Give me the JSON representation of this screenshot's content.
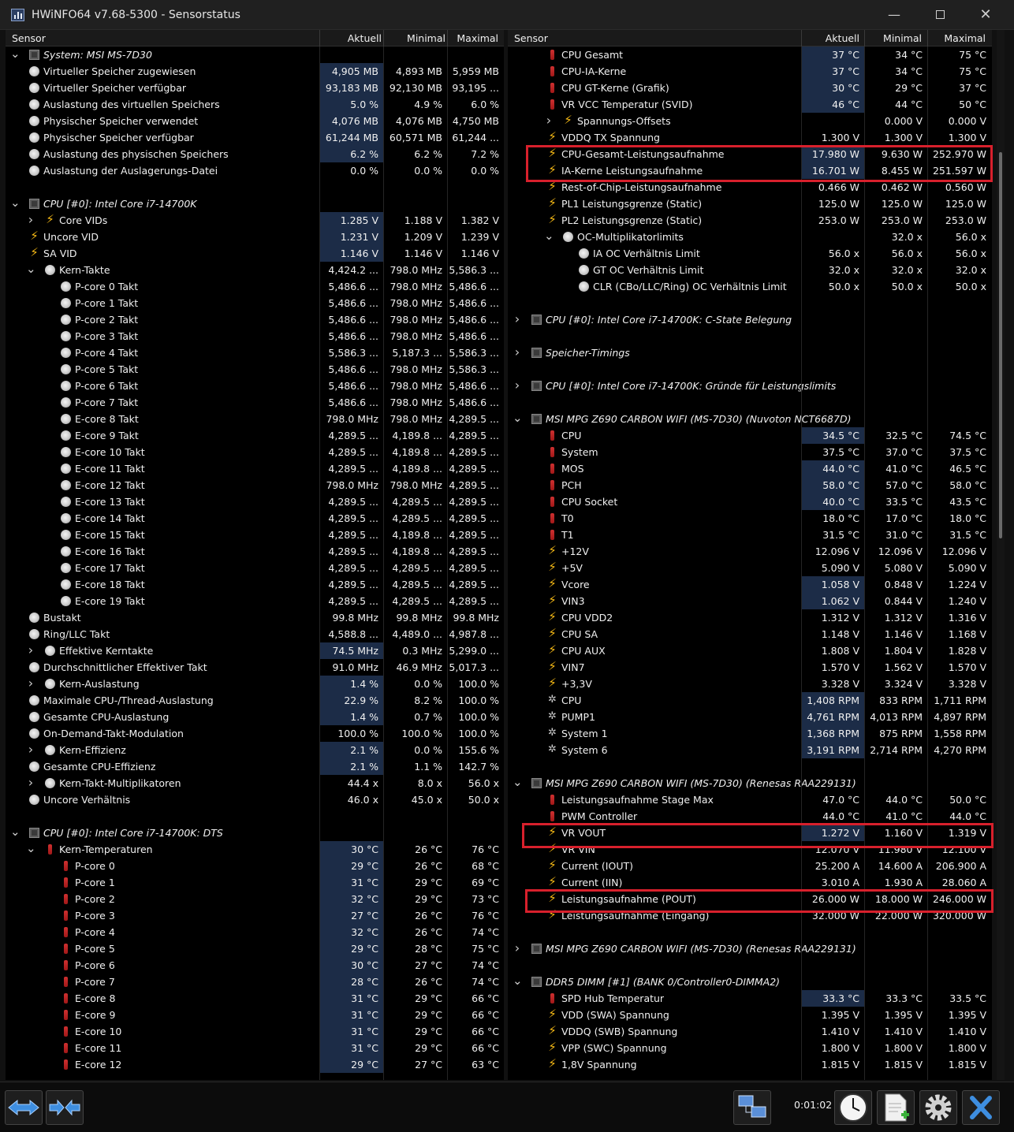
{
  "window": {
    "title": "HWiNFO64 v7.68-5300 - Sensorstatus"
  },
  "columns": {
    "sensor": "Sensor",
    "current": "Aktuell",
    "min": "Minimal",
    "max": "Maximal"
  },
  "left_rows": [
    {
      "exp": "v",
      "icon": "chip",
      "indent": 0,
      "name": "System: MSI MS-7D30",
      "group": true
    },
    {
      "icon": "clock",
      "indent": 0,
      "name": "Virtueller Speicher zugewiesen",
      "cur": "4,905 MB",
      "min": "4,893 MB",
      "max": "5,959 MB",
      "hl": true
    },
    {
      "icon": "clock",
      "indent": 0,
      "name": "Virtueller Speicher verfügbar",
      "cur": "93,183 MB",
      "min": "92,130 MB",
      "max": "93,195 ...",
      "hl": true
    },
    {
      "icon": "clock",
      "indent": 0,
      "name": "Auslastung des virtuellen Speichers",
      "cur": "5.0 %",
      "min": "4.9 %",
      "max": "6.0 %",
      "hl": true
    },
    {
      "icon": "clock",
      "indent": 0,
      "name": "Physischer Speicher verwendet",
      "cur": "4,076 MB",
      "min": "4,076 MB",
      "max": "4,750 MB",
      "hl": true
    },
    {
      "icon": "clock",
      "indent": 0,
      "name": "Physischer Speicher verfügbar",
      "cur": "61,244 MB",
      "min": "60,571 MB",
      "max": "61,244 ...",
      "hl": true
    },
    {
      "icon": "clock",
      "indent": 0,
      "name": "Auslastung des physischen Speichers",
      "cur": "6.2 %",
      "min": "6.2 %",
      "max": "7.2 %",
      "hl": true
    },
    {
      "icon": "clock",
      "indent": 0,
      "name": "Auslastung der Auslagerungs-Datei",
      "cur": "0.0 %",
      "min": "0.0 %",
      "max": "0.0 %"
    },
    {
      "empty": true
    },
    {
      "exp": "v",
      "icon": "chip",
      "indent": 0,
      "name": "CPU [#0]: Intel Core i7-14700K",
      "group": true
    },
    {
      "exp": ">",
      "icon": "bolt",
      "indent": 1,
      "name": "Core VIDs",
      "cur": "1.285 V",
      "min": "1.188 V",
      "max": "1.382 V",
      "hl": true
    },
    {
      "icon": "bolt",
      "indent": 0,
      "name": "Uncore VID",
      "cur": "1.231 V",
      "min": "1.209 V",
      "max": "1.239 V",
      "hl": true
    },
    {
      "icon": "bolt",
      "indent": 0,
      "name": "SA VID",
      "cur": "1.146 V",
      "min": "1.146 V",
      "max": "1.146 V",
      "hl": true
    },
    {
      "exp": "v",
      "icon": "clock",
      "indent": 1,
      "name": "Kern-Takte",
      "cur": "4,424.2 ...",
      "min": "798.0 MHz",
      "max": "5,586.3 ..."
    },
    {
      "icon": "clock",
      "indent": 2,
      "name": "P-core 0 Takt",
      "cur": "5,486.6 ...",
      "min": "798.0 MHz",
      "max": "5,486.6 ..."
    },
    {
      "icon": "clock",
      "indent": 2,
      "name": "P-core 1 Takt",
      "cur": "5,486.6 ...",
      "min": "798.0 MHz",
      "max": "5,486.6 ..."
    },
    {
      "icon": "clock",
      "indent": 2,
      "name": "P-core 2 Takt",
      "cur": "5,486.6 ...",
      "min": "798.0 MHz",
      "max": "5,486.6 ..."
    },
    {
      "icon": "clock",
      "indent": 2,
      "name": "P-core 3 Takt",
      "cur": "5,486.6 ...",
      "min": "798.0 MHz",
      "max": "5,486.6 ..."
    },
    {
      "icon": "clock",
      "indent": 2,
      "name": "P-core 4 Takt",
      "cur": "5,586.3 ...",
      "min": "5,187.3 ...",
      "max": "5,586.3 ..."
    },
    {
      "icon": "clock",
      "indent": 2,
      "name": "P-core 5 Takt",
      "cur": "5,486.6 ...",
      "min": "798.0 MHz",
      "max": "5,586.3 ..."
    },
    {
      "icon": "clock",
      "indent": 2,
      "name": "P-core 6 Takt",
      "cur": "5,486.6 ...",
      "min": "798.0 MHz",
      "max": "5,486.6 ..."
    },
    {
      "icon": "clock",
      "indent": 2,
      "name": "P-core 7 Takt",
      "cur": "5,486.6 ...",
      "min": "798.0 MHz",
      "max": "5,486.6 ..."
    },
    {
      "icon": "clock",
      "indent": 2,
      "name": "E-core 8 Takt",
      "cur": "798.0 MHz",
      "min": "798.0 MHz",
      "max": "4,289.5 ..."
    },
    {
      "icon": "clock",
      "indent": 2,
      "name": "E-core 9 Takt",
      "cur": "4,289.5 ...",
      "min": "4,189.8 ...",
      "max": "4,289.5 ..."
    },
    {
      "icon": "clock",
      "indent": 2,
      "name": "E-core 10 Takt",
      "cur": "4,289.5 ...",
      "min": "4,189.8 ...",
      "max": "4,289.5 ..."
    },
    {
      "icon": "clock",
      "indent": 2,
      "name": "E-core 11 Takt",
      "cur": "4,289.5 ...",
      "min": "4,189.8 ...",
      "max": "4,289.5 ..."
    },
    {
      "icon": "clock",
      "indent": 2,
      "name": "E-core 12 Takt",
      "cur": "798.0 MHz",
      "min": "798.0 MHz",
      "max": "4,289.5 ..."
    },
    {
      "icon": "clock",
      "indent": 2,
      "name": "E-core 13 Takt",
      "cur": "4,289.5 ...",
      "min": "4,289.5 ...",
      "max": "4,289.5 ..."
    },
    {
      "icon": "clock",
      "indent": 2,
      "name": "E-core 14 Takt",
      "cur": "4,289.5 ...",
      "min": "4,289.5 ...",
      "max": "4,289.5 ..."
    },
    {
      "icon": "clock",
      "indent": 2,
      "name": "E-core 15 Takt",
      "cur": "4,289.5 ...",
      "min": "4,189.8 ...",
      "max": "4,289.5 ..."
    },
    {
      "icon": "clock",
      "indent": 2,
      "name": "E-core 16 Takt",
      "cur": "4,289.5 ...",
      "min": "4,189.8 ...",
      "max": "4,289.5 ..."
    },
    {
      "icon": "clock",
      "indent": 2,
      "name": "E-core 17 Takt",
      "cur": "4,289.5 ...",
      "min": "4,289.5 ...",
      "max": "4,289.5 ..."
    },
    {
      "icon": "clock",
      "indent": 2,
      "name": "E-core 18 Takt",
      "cur": "4,289.5 ...",
      "min": "4,289.5 ...",
      "max": "4,289.5 ..."
    },
    {
      "icon": "clock",
      "indent": 2,
      "name": "E-core 19 Takt",
      "cur": "4,289.5 ...",
      "min": "4,289.5 ...",
      "max": "4,289.5 ..."
    },
    {
      "icon": "clock",
      "indent": 0,
      "name": "Bustakt",
      "cur": "99.8 MHz",
      "min": "99.8 MHz",
      "max": "99.8 MHz"
    },
    {
      "icon": "clock",
      "indent": 0,
      "name": "Ring/LLC Takt",
      "cur": "4,588.8 ...",
      "min": "4,489.0 ...",
      "max": "4,987.8 ..."
    },
    {
      "exp": ">",
      "icon": "clock",
      "indent": 1,
      "name": "Effektive Kerntakte",
      "cur": "74.5 MHz",
      "min": "0.3 MHz",
      "max": "5,299.0 ...",
      "hl": true
    },
    {
      "icon": "clock",
      "indent": 0,
      "name": "Durchschnittlicher Effektiver Takt",
      "cur": "91.0 MHz",
      "min": "46.9 MHz",
      "max": "5,017.3 ..."
    },
    {
      "exp": ">",
      "icon": "clock",
      "indent": 1,
      "name": "Kern-Auslastung",
      "cur": "1.4 %",
      "min": "0.0 %",
      "max": "100.0 %",
      "hl": true
    },
    {
      "icon": "clock",
      "indent": 0,
      "name": "Maximale CPU-/Thread-Auslastung",
      "cur": "22.9 %",
      "min": "8.2 %",
      "max": "100.0 %",
      "hl": true
    },
    {
      "icon": "clock",
      "indent": 0,
      "name": "Gesamte CPU-Auslastung",
      "cur": "1.4 %",
      "min": "0.7 %",
      "max": "100.0 %",
      "hl": true
    },
    {
      "icon": "clock",
      "indent": 0,
      "name": "On-Demand-Takt-Modulation",
      "cur": "100.0 %",
      "min": "100.0 %",
      "max": "100.0 %"
    },
    {
      "exp": ">",
      "icon": "clock",
      "indent": 1,
      "name": "Kern-Effizienz",
      "cur": "2.1 %",
      "min": "0.0 %",
      "max": "155.6 %",
      "hl": true
    },
    {
      "icon": "clock",
      "indent": 0,
      "name": "Gesamte CPU-Effizienz",
      "cur": "2.1 %",
      "min": "1.1 %",
      "max": "142.7 %",
      "hl": true
    },
    {
      "exp": ">",
      "icon": "clock",
      "indent": 1,
      "name": "Kern-Takt-Multiplikatoren",
      "cur": "44.4 x",
      "min": "8.0 x",
      "max": "56.0 x"
    },
    {
      "icon": "clock",
      "indent": 0,
      "name": "Uncore Verhältnis",
      "cur": "46.0 x",
      "min": "45.0 x",
      "max": "50.0 x"
    },
    {
      "empty": true
    },
    {
      "exp": "v",
      "icon": "chip",
      "indent": 0,
      "name": "CPU [#0]: Intel Core i7-14700K: DTS",
      "group": true
    },
    {
      "exp": "v",
      "icon": "therm",
      "indent": 1,
      "name": "Kern-Temperaturen",
      "cur": "30 °C",
      "min": "26 °C",
      "max": "76 °C",
      "hl": true
    },
    {
      "icon": "therm",
      "indent": 2,
      "name": "P-core 0",
      "cur": "29 °C",
      "min": "26 °C",
      "max": "68 °C",
      "hl": true
    },
    {
      "icon": "therm",
      "indent": 2,
      "name": "P-core 1",
      "cur": "31 °C",
      "min": "29 °C",
      "max": "69 °C",
      "hl": true
    },
    {
      "icon": "therm",
      "indent": 2,
      "name": "P-core 2",
      "cur": "32 °C",
      "min": "29 °C",
      "max": "73 °C",
      "hl": true
    },
    {
      "icon": "therm",
      "indent": 2,
      "name": "P-core 3",
      "cur": "27 °C",
      "min": "26 °C",
      "max": "76 °C",
      "hl": true
    },
    {
      "icon": "therm",
      "indent": 2,
      "name": "P-core 4",
      "cur": "32 °C",
      "min": "26 °C",
      "max": "74 °C",
      "hl": true
    },
    {
      "icon": "therm",
      "indent": 2,
      "name": "P-core 5",
      "cur": "29 °C",
      "min": "28 °C",
      "max": "75 °C",
      "hl": true
    },
    {
      "icon": "therm",
      "indent": 2,
      "name": "P-core 6",
      "cur": "30 °C",
      "min": "27 °C",
      "max": "74 °C",
      "hl": true
    },
    {
      "icon": "therm",
      "indent": 2,
      "name": "P-core 7",
      "cur": "28 °C",
      "min": "26 °C",
      "max": "74 °C",
      "hl": true
    },
    {
      "icon": "therm",
      "indent": 2,
      "name": "E-core 8",
      "cur": "31 °C",
      "min": "29 °C",
      "max": "66 °C",
      "hl": true
    },
    {
      "icon": "therm",
      "indent": 2,
      "name": "E-core 9",
      "cur": "31 °C",
      "min": "29 °C",
      "max": "66 °C",
      "hl": true
    },
    {
      "icon": "therm",
      "indent": 2,
      "name": "E-core 10",
      "cur": "31 °C",
      "min": "29 °C",
      "max": "66 °C",
      "hl": true
    },
    {
      "icon": "therm",
      "indent": 2,
      "name": "E-core 11",
      "cur": "31 °C",
      "min": "29 °C",
      "max": "66 °C",
      "hl": true
    },
    {
      "icon": "therm",
      "indent": 2,
      "name": "E-core 12",
      "cur": "29 °C",
      "min": "27 °C",
      "max": "63 °C",
      "hl": true
    }
  ],
  "right_rows": [
    {
      "icon": "therm",
      "indent": 1,
      "name": "CPU Gesamt",
      "cur": "37 °C",
      "min": "34 °C",
      "max": "75 °C",
      "hl": true
    },
    {
      "icon": "therm",
      "indent": 1,
      "name": "CPU-IA-Kerne",
      "cur": "37 °C",
      "min": "34 °C",
      "max": "75 °C",
      "hl": true
    },
    {
      "icon": "therm",
      "indent": 1,
      "name": "CPU GT-Kerne (Grafik)",
      "cur": "30 °C",
      "min": "29 °C",
      "max": "37 °C",
      "hl": true
    },
    {
      "icon": "therm",
      "indent": 1,
      "name": "VR VCC Temperatur (SVID)",
      "cur": "46 °C",
      "min": "44 °C",
      "max": "50 °C",
      "hl": true
    },
    {
      "exp": ">",
      "icon": "bolt",
      "indent": 2,
      "name": "Spannungs-Offsets",
      "cur": "",
      "min": "0.000 V",
      "max": "0.000 V"
    },
    {
      "icon": "bolt",
      "indent": 1,
      "name": "VDDQ TX Spannung",
      "cur": "1.300 V",
      "min": "1.300 V",
      "max": "1.300 V"
    },
    {
      "icon": "bolt",
      "indent": 1,
      "name": "CPU-Gesamt-Leistungsaufnahme",
      "cur": "17.980 W",
      "min": "9.630 W",
      "max": "252.970 W",
      "hl": true
    },
    {
      "icon": "bolt",
      "indent": 1,
      "name": "IA-Kerne Leistungsaufnahme",
      "cur": "16.701 W",
      "min": "8.455 W",
      "max": "251.597 W",
      "hl": true
    },
    {
      "icon": "bolt",
      "indent": 1,
      "name": "Rest-of-Chip-Leistungsaufnahme",
      "cur": "0.466 W",
      "min": "0.462 W",
      "max": "0.560 W"
    },
    {
      "icon": "bolt",
      "indent": 1,
      "name": "PL1 Leistungsgrenze (Static)",
      "cur": "125.0 W",
      "min": "125.0 W",
      "max": "125.0 W"
    },
    {
      "icon": "bolt",
      "indent": 1,
      "name": "PL2 Leistungsgrenze (Static)",
      "cur": "253.0 W",
      "min": "253.0 W",
      "max": "253.0 W"
    },
    {
      "exp": "v",
      "icon": "clock",
      "indent": 2,
      "name": "OC-Multiplikatorlimits",
      "cur": "",
      "min": "32.0 x",
      "max": "56.0 x"
    },
    {
      "icon": "clock",
      "indent": 3,
      "name": "IA OC Verhältnis Limit",
      "cur": "56.0 x",
      "min": "56.0 x",
      "max": "56.0 x"
    },
    {
      "icon": "clock",
      "indent": 3,
      "name": "GT OC Verhältnis Limit",
      "cur": "32.0 x",
      "min": "32.0 x",
      "max": "32.0 x"
    },
    {
      "icon": "clock",
      "indent": 3,
      "name": "CLR (CBo/LLC/Ring) OC Verhältnis Limit",
      "cur": "50.0 x",
      "min": "50.0 x",
      "max": "50.0 x"
    },
    {
      "empty": true
    },
    {
      "exp": ">",
      "icon": "chip",
      "indent": 0,
      "name": "CPU [#0]: Intel Core i7-14700K: C-State Belegung",
      "group": true
    },
    {
      "empty": true
    },
    {
      "exp": ">",
      "icon": "chip",
      "indent": 0,
      "name": "Speicher-Timings",
      "group": true
    },
    {
      "empty": true
    },
    {
      "exp": ">",
      "icon": "chip",
      "indent": 0,
      "name": "CPU [#0]: Intel Core i7-14700K: Gründe für Leistungslimits",
      "group": true
    },
    {
      "empty": true
    },
    {
      "exp": "v",
      "icon": "chip",
      "indent": 0,
      "name": "MSI MPG Z690 CARBON WIFI (MS-7D30) (Nuvoton NCT6687D)",
      "group": true
    },
    {
      "icon": "therm",
      "indent": 1,
      "name": "CPU",
      "cur": "34.5 °C",
      "min": "32.5 °C",
      "max": "74.5 °C",
      "hl": true
    },
    {
      "icon": "therm",
      "indent": 1,
      "name": "System",
      "cur": "37.5 °C",
      "min": "37.0 °C",
      "max": "37.5 °C"
    },
    {
      "icon": "therm",
      "indent": 1,
      "name": "MOS",
      "cur": "44.0 °C",
      "min": "41.0 °C",
      "max": "46.5 °C",
      "hl": true
    },
    {
      "icon": "therm",
      "indent": 1,
      "name": "PCH",
      "cur": "58.0 °C",
      "min": "57.0 °C",
      "max": "58.0 °C",
      "hl": true
    },
    {
      "icon": "therm",
      "indent": 1,
      "name": "CPU Socket",
      "cur": "40.0 °C",
      "min": "33.5 °C",
      "max": "43.5 °C",
      "hl": true
    },
    {
      "icon": "therm",
      "indent": 1,
      "name": "T0",
      "cur": "18.0 °C",
      "min": "17.0 °C",
      "max": "18.0 °C"
    },
    {
      "icon": "therm",
      "indent": 1,
      "name": "T1",
      "cur": "31.5 °C",
      "min": "31.0 °C",
      "max": "31.5 °C"
    },
    {
      "icon": "bolt",
      "indent": 1,
      "name": "+12V",
      "cur": "12.096 V",
      "min": "12.096 V",
      "max": "12.096 V"
    },
    {
      "icon": "bolt",
      "indent": 1,
      "name": "+5V",
      "cur": "5.090 V",
      "min": "5.080 V",
      "max": "5.090 V"
    },
    {
      "icon": "bolt",
      "indent": 1,
      "name": "Vcore",
      "cur": "1.058 V",
      "min": "0.848 V",
      "max": "1.224 V",
      "hl": true
    },
    {
      "icon": "bolt",
      "indent": 1,
      "name": "VIN3",
      "cur": "1.062 V",
      "min": "0.844 V",
      "max": "1.240 V",
      "hl": true
    },
    {
      "icon": "bolt",
      "indent": 1,
      "name": "CPU VDD2",
      "cur": "1.312 V",
      "min": "1.312 V",
      "max": "1.316 V"
    },
    {
      "icon": "bolt",
      "indent": 1,
      "name": "CPU SA",
      "cur": "1.148 V",
      "min": "1.146 V",
      "max": "1.168 V"
    },
    {
      "icon": "bolt",
      "indent": 1,
      "name": "CPU AUX",
      "cur": "1.808 V",
      "min": "1.804 V",
      "max": "1.828 V"
    },
    {
      "icon": "bolt",
      "indent": 1,
      "name": "VIN7",
      "cur": "1.570 V",
      "min": "1.562 V",
      "max": "1.570 V"
    },
    {
      "icon": "bolt",
      "indent": 1,
      "name": "+3,3V",
      "cur": "3.328 V",
      "min": "3.324 V",
      "max": "3.328 V"
    },
    {
      "icon": "fan",
      "indent": 1,
      "name": "CPU",
      "cur": "1,408 RPM",
      "min": "833 RPM",
      "max": "1,711 RPM",
      "hl": true
    },
    {
      "icon": "fan",
      "indent": 1,
      "name": "PUMP1",
      "cur": "4,761 RPM",
      "min": "4,013 RPM",
      "max": "4,897 RPM",
      "hl": true
    },
    {
      "icon": "fan",
      "indent": 1,
      "name": "System 1",
      "cur": "1,368 RPM",
      "min": "875 RPM",
      "max": "1,558 RPM",
      "hl": true
    },
    {
      "icon": "fan",
      "indent": 1,
      "name": "System 6",
      "cur": "3,191 RPM",
      "min": "2,714 RPM",
      "max": "4,270 RPM",
      "hl": true
    },
    {
      "empty": true
    },
    {
      "exp": "v",
      "icon": "chip",
      "indent": 0,
      "name": "MSI MPG Z690 CARBON WIFI (MS-7D30) (Renesas RAA229131)",
      "group": true
    },
    {
      "icon": "therm",
      "indent": 1,
      "name": "Leistungsaufnahme Stage Max",
      "cur": "47.0 °C",
      "min": "44.0 °C",
      "max": "50.0 °C"
    },
    {
      "icon": "therm",
      "indent": 1,
      "name": "PWM Controller",
      "cur": "44.0 °C",
      "min": "41.0 °C",
      "max": "44.0 °C"
    },
    {
      "icon": "bolt",
      "indent": 1,
      "name": "VR VOUT",
      "cur": "1.272 V",
      "min": "1.160 V",
      "max": "1.319 V",
      "hl": true
    },
    {
      "icon": "bolt",
      "indent": 1,
      "name": "VR VIN",
      "cur": "12.070 V",
      "min": "11.980 V",
      "max": "12.100 V"
    },
    {
      "icon": "bolt",
      "indent": 1,
      "name": "Current (IOUT)",
      "cur": "25.200 A",
      "min": "14.600 A",
      "max": "206.900 A"
    },
    {
      "icon": "bolt",
      "indent": 1,
      "name": "Current (IIN)",
      "cur": "3.010 A",
      "min": "1.930 A",
      "max": "28.060 A"
    },
    {
      "icon": "bolt",
      "indent": 1,
      "name": "Leistungsaufnahme (POUT)",
      "cur": "26.000 W",
      "min": "18.000 W",
      "max": "246.000 W"
    },
    {
      "icon": "bolt",
      "indent": 1,
      "name": "Leistungsaufnahme (Eingang)",
      "cur": "32.000 W",
      "min": "22.000 W",
      "max": "320.000 W"
    },
    {
      "empty": true
    },
    {
      "exp": ">",
      "icon": "chip",
      "indent": 0,
      "name": "MSI MPG Z690 CARBON WIFI (MS-7D30) (Renesas RAA229131)",
      "group": true
    },
    {
      "empty": true
    },
    {
      "exp": "v",
      "icon": "chip",
      "indent": 0,
      "name": "DDR5 DIMM [#1] (BANK 0/Controller0-DIMMA2)",
      "group": true
    },
    {
      "icon": "therm",
      "indent": 1,
      "name": "SPD Hub Temperatur",
      "cur": "33.3 °C",
      "min": "33.3 °C",
      "max": "33.5 °C",
      "hl": true
    },
    {
      "icon": "bolt",
      "indent": 1,
      "name": "VDD (SWA) Spannung",
      "cur": "1.395 V",
      "min": "1.395 V",
      "max": "1.395 V"
    },
    {
      "icon": "bolt",
      "indent": 1,
      "name": "VDDQ (SWB) Spannung",
      "cur": "1.410 V",
      "min": "1.410 V",
      "max": "1.410 V"
    },
    {
      "icon": "bolt",
      "indent": 1,
      "name": "VPP (SWC) Spannung",
      "cur": "1.800 V",
      "min": "1.800 V",
      "max": "1.800 V"
    },
    {
      "icon": "bolt",
      "indent": 1,
      "name": "1,8V Spannung",
      "cur": "1.815 V",
      "min": "1.815 V",
      "max": "1.815 V"
    }
  ],
  "toolbar": {
    "timer": "0:01:02"
  },
  "colors": {
    "highlight_cell": "#1c2c47",
    "annotation_red": "#d8202c",
    "bolt": "#f5b915"
  }
}
